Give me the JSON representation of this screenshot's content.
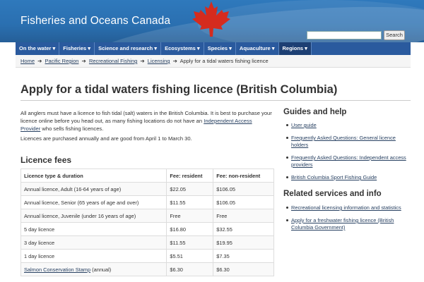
{
  "header": {
    "site_title": "Fisheries and Oceans Canada",
    "search_placeholder": "",
    "search_button": "Search"
  },
  "nav": [
    {
      "label": "On the water ▾"
    },
    {
      "label": "Fisheries ▾"
    },
    {
      "label": "Science and research ▾"
    },
    {
      "label": "Ecosystems ▾"
    },
    {
      "label": "Species ▾"
    },
    {
      "label": "Aquaculture ▾"
    },
    {
      "label": "Regions ▾"
    }
  ],
  "breadcrumb": {
    "home": "Home",
    "pacific": "Pacific Region",
    "recreational": "Recreational Fishing",
    "licensing": "Licensing",
    "current": "Apply for a tidal waters fishing licence",
    "sep": "➔"
  },
  "page": {
    "title": "Apply for a tidal waters fishing licence (British Columbia)",
    "intro_text": "All anglers must have a licence to fish tidal (salt) waters in the British Columbia. It is best to purchase your licence online before you head out, as many fishing locations do not have an ",
    "intro_link": "Independent Access Provider",
    "intro_tail": " who sells fishing licences.",
    "note": "Licences are purchased annually and are good from April 1 to March 30.",
    "fees_heading": "Licence fees"
  },
  "table": {
    "headers": [
      "Licence type & duration",
      "Fee: resident",
      "Fee: non-resident"
    ],
    "rows": [
      [
        "Annual licence, Adult (16-64 years of age)",
        "$22.05",
        "$106.05"
      ],
      [
        "Annual licence, Senior (65 years of age and over)",
        "$11.55",
        "$106.05"
      ],
      [
        "Annual licence, Juvenile (under 16 years of age)",
        "Free",
        "Free"
      ],
      [
        "5 day licence",
        "$16.80",
        "$32.55"
      ],
      [
        "3 day licence",
        "$11.55",
        "$19.95"
      ],
      [
        "1 day licence",
        "$5.51",
        "$7.35"
      ]
    ],
    "last_row": {
      "link": "Salmon Conservation Stamp",
      "suffix": " (annual)",
      "resident": "$6.30",
      "non_resident": "$6.30"
    }
  },
  "sidebar": {
    "guides_heading": "Guides and help",
    "guides": [
      "User guide",
      "Frequently Asked Questions: General licence holders",
      "Frequently Asked Questions: Independent access providers",
      "British Columbia Sport Fishing Guide"
    ],
    "related_heading": "Related services and info",
    "related": [
      "Recreational licensing information and statistics",
      "Apply for a freshwater fishing licence (British Columbia Government)"
    ]
  },
  "colors": {
    "header_blue": "#2f79bc",
    "nav_blue": "#2a5a9e",
    "flag_red": "#d52b1e",
    "link": "#284162"
  }
}
